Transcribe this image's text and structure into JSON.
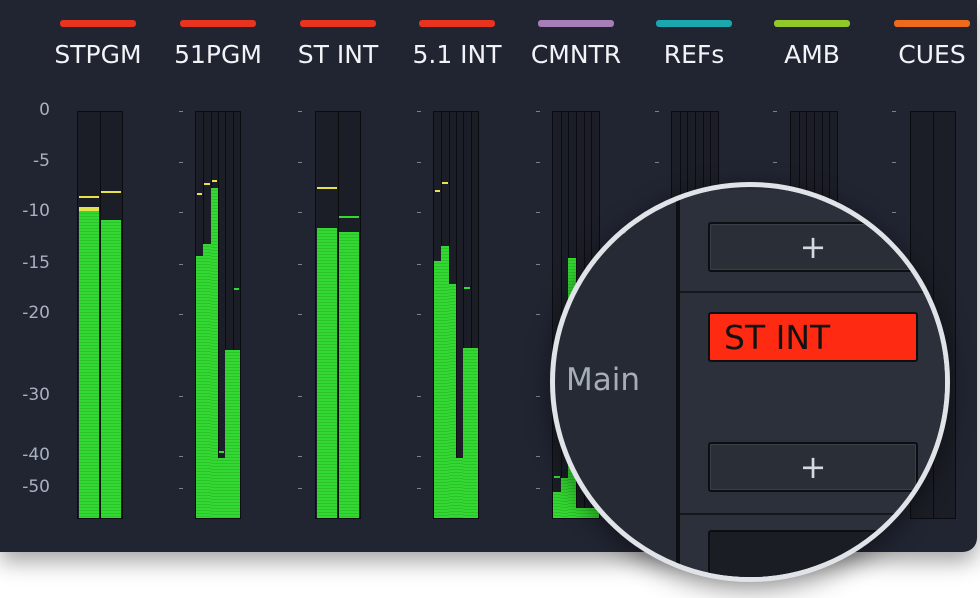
{
  "scale": [
    "0",
    "-5",
    "-10",
    "-15",
    "-20",
    "-30",
    "-40",
    "-50"
  ],
  "buses": [
    {
      "label": "STPGM",
      "color": "#e8331f"
    },
    {
      "label": "51PGM",
      "color": "#e8331f"
    },
    {
      "label": "ST INT",
      "color": "#e8331f"
    },
    {
      "label": "5.1 INT",
      "color": "#e8331f"
    },
    {
      "label": "CMNTR",
      "color": "#a77fb8"
    },
    {
      "label": "REFs",
      "color": "#1aa7ad"
    },
    {
      "label": "AMB",
      "color": "#93c82a"
    },
    {
      "label": "CUES",
      "color": "#ee6b1e"
    }
  ],
  "magnifier": {
    "partial_label": "s",
    "section_label": "Main",
    "add_label": "+",
    "active_label": "ST INT"
  }
}
